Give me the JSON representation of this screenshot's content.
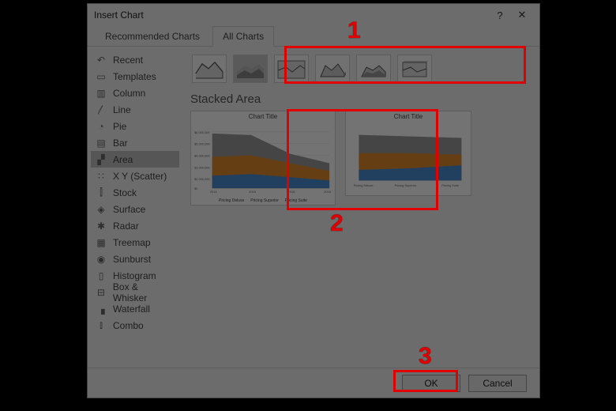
{
  "dialog": {
    "title": "Insert Chart",
    "help_glyph": "?",
    "close_glyph": "✕"
  },
  "tabs": {
    "recommended": "Recommended Charts",
    "all": "All Charts"
  },
  "sidebar": {
    "items": [
      {
        "label": "Recent",
        "icon": "↶"
      },
      {
        "label": "Templates",
        "icon": "▭"
      },
      {
        "label": "Column",
        "icon": "▥"
      },
      {
        "label": "Line",
        "icon": "〳"
      },
      {
        "label": "Pie",
        "icon": "◔"
      },
      {
        "label": "Bar",
        "icon": "▤"
      },
      {
        "label": "Area",
        "icon": "▞"
      },
      {
        "label": "X Y (Scatter)",
        "icon": "∷"
      },
      {
        "label": "Stock",
        "icon": "⫿"
      },
      {
        "label": "Surface",
        "icon": "◈"
      },
      {
        "label": "Radar",
        "icon": "✱"
      },
      {
        "label": "Treemap",
        "icon": "▦"
      },
      {
        "label": "Sunburst",
        "icon": "◉"
      },
      {
        "label": "Histogram",
        "icon": "▯"
      },
      {
        "label": "Box & Whisker",
        "icon": "⊟"
      },
      {
        "label": "Waterfall",
        "icon": "▗"
      },
      {
        "label": "Combo",
        "icon": "⫾"
      }
    ],
    "selected_index": 6
  },
  "subtype": {
    "selected_index": 1,
    "title": "Stacked Area"
  },
  "preview1": {
    "title": "Chart Title",
    "legend": [
      "Pricing Deluxe",
      "Pricing Superior",
      "Pricing Suite"
    ]
  },
  "preview2": {
    "title": "Chart Title",
    "legend": [
      "Pricing Deluxe",
      "Pricing Superior",
      "Pricing Suite"
    ]
  },
  "chart_data": [
    {
      "type": "area",
      "title": "Chart Title",
      "xlabel": "",
      "ylabel": "",
      "ylim": [
        0,
        6000000
      ],
      "yticks": [
        0,
        1000000,
        2000000,
        3000000,
        4000000,
        5000000,
        6000000
      ],
      "categories": [
        "2014",
        "2015",
        "2016",
        "2018"
      ],
      "series": [
        {
          "name": "Pricing Deluxe",
          "values": [
            1200000,
            1300000,
            1100000,
            800000
          ],
          "color": "#4a8fd6"
        },
        {
          "name": "Pricing Superior",
          "values": [
            2000000,
            2100000,
            1700000,
            1300000
          ],
          "color": "#e08a2c"
        },
        {
          "name": "Pricing Suite",
          "values": [
            2500000,
            2000000,
            1000000,
            900000
          ],
          "color": "#9a9a9a"
        }
      ],
      "stacked": true
    },
    {
      "type": "area",
      "title": "Chart Title",
      "xlabel": "",
      "ylabel": "",
      "ylim": [
        0,
        100
      ],
      "categories": [
        "Pricing Deluxe",
        "Pricing Superior",
        "Pricing Suite"
      ],
      "series": [
        {
          "name": "Pricing Deluxe",
          "values": [
            25,
            28,
            33
          ],
          "color": "#4a8fd6"
        },
        {
          "name": "Pricing Superior",
          "values": [
            35,
            34,
            33
          ],
          "color": "#e08a2c"
        },
        {
          "name": "Pricing Suite",
          "values": [
            40,
            38,
            34
          ],
          "color": "#9a9a9a"
        }
      ],
      "stacked": true
    }
  ],
  "buttons": {
    "ok": "OK",
    "cancel": "Cancel"
  },
  "annotations": {
    "n1": "1",
    "n2": "2",
    "n3": "3"
  }
}
